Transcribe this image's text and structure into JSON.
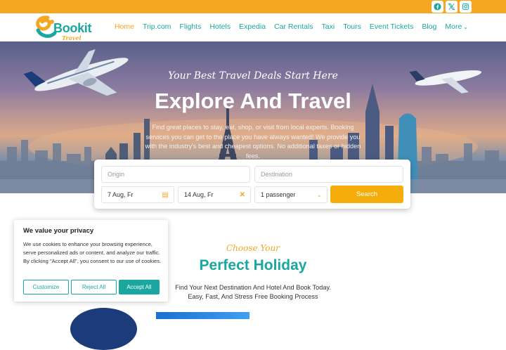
{
  "header": {
    "logo_text": "Bookit",
    "logo_sub": "Travel",
    "nav": [
      {
        "label": "Home",
        "active": true
      },
      {
        "label": "Trip.com"
      },
      {
        "label": "Flights"
      },
      {
        "label": "Hotels"
      },
      {
        "label": "Expedia"
      },
      {
        "label": "Car Rentals"
      },
      {
        "label": "Taxi"
      },
      {
        "label": "Tours"
      },
      {
        "label": "Event Tickets"
      },
      {
        "label": "Blog"
      },
      {
        "label": "More"
      }
    ]
  },
  "social": [
    "facebook-icon",
    "x-icon",
    "instagram-icon"
  ],
  "hero": {
    "tagline": "Your Best Travel Deals Start Here",
    "title": "Explore And Travel",
    "description": "Find great places to stay, eat, shop, or visit from local experts. Booking services you can get to the place you have always wanted! We provide you with the industry's best and cheapest options. No additional taxes or hidden fees."
  },
  "search": {
    "origin_placeholder": "Origin",
    "destination_placeholder": "Destination",
    "depart_date": "7 Aug, Fr",
    "return_date": "14 Aug, Fr",
    "passengers": "1 passenger",
    "button": "Search"
  },
  "section": {
    "script": "Choose Your",
    "title": "Perfect Holiday",
    "desc_line1": "Find Your Next Destination And Hotel And Book Today.",
    "desc_line2": "Easy, Fast, And Stress Free Booking Process"
  },
  "cookie": {
    "title": "We value your privacy",
    "text": "We use cookies to enhance your browsing experience, serve personalized ads or content, and analyze our traffic. By clicking \"Accept All\", you consent to our use of cookies.",
    "customize": "Customize",
    "reject": "Reject All",
    "accept": "Accept All"
  },
  "colors": {
    "accent_orange": "#f5a623",
    "accent_teal": "#1aa7a0"
  }
}
